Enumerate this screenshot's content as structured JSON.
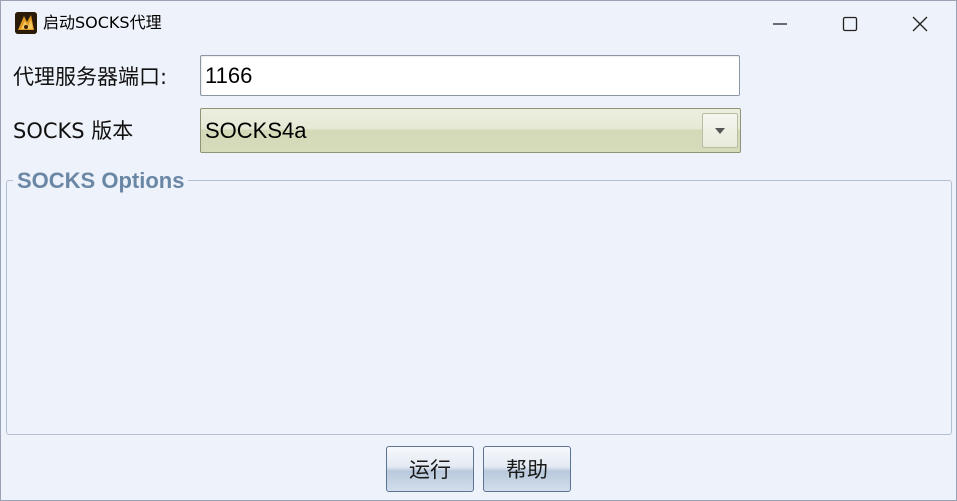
{
  "window": {
    "title": "启动SOCKS代理",
    "controls": {
      "minimize": "minimize-icon",
      "maximize": "maximize-icon",
      "close": "close-icon"
    }
  },
  "form": {
    "port_label": "代理服务器端口:",
    "port_value": "1166",
    "version_label": "SOCKS 版本",
    "version_selected": "SOCKS4a"
  },
  "options_group": {
    "title": "SOCKS Options"
  },
  "buttons": {
    "run": "运行",
    "help": "帮助"
  },
  "colors": {
    "background": "#eef2fa",
    "group_title": "#6b87a6",
    "select_fill": "#d6dbbb"
  }
}
